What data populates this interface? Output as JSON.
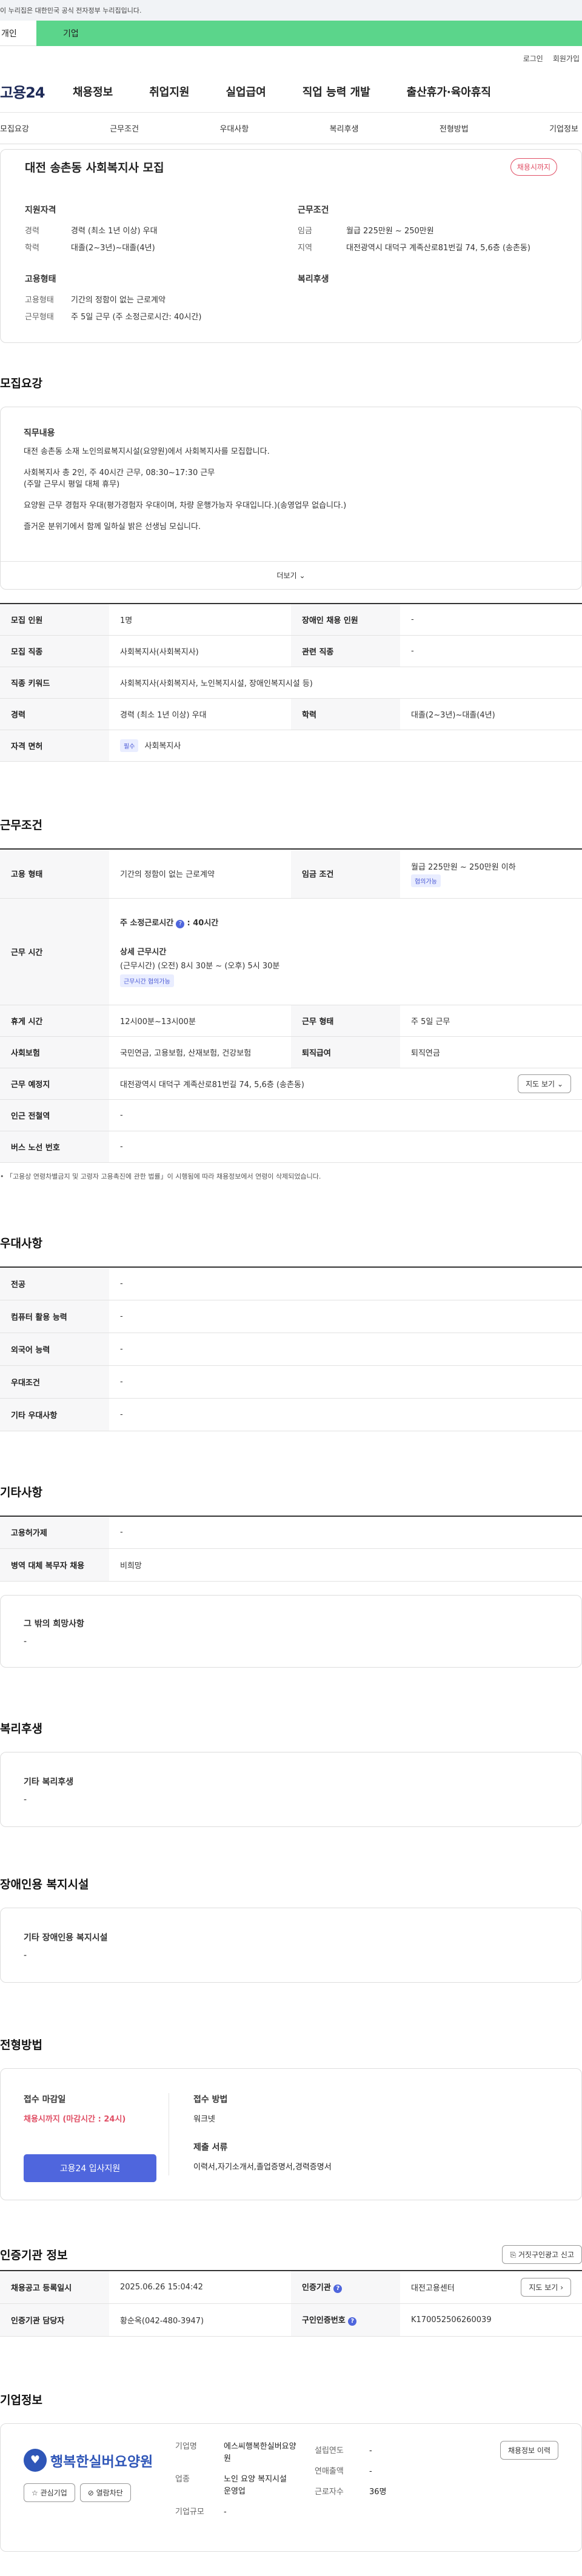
{
  "banner": {
    "text": "이 누리집은 대한민국 공식 전자정부 누리집입니다."
  },
  "top_tabs": [
    "개인",
    "기업"
  ],
  "util": [
    "로그인",
    "회원가입"
  ],
  "logo": "고용24",
  "gnb": [
    "채용정보",
    "취업지원",
    "실업급여",
    "직업 능력 개발",
    "출산휴가·육아휴직"
  ],
  "subnav": [
    "모집요강",
    "근무조건",
    "우대사항",
    "복리후생",
    "전형방법",
    "기업정보"
  ],
  "header": {
    "title": "대전 송촌동 사회복지사 모집",
    "badge": "채용시까지",
    "qual_title": "지원자격",
    "career_k": "경력",
    "career_v": "경력 (최소 1년 이상) 우대",
    "edu_k": "학력",
    "edu_v": "대졸(2~3년)~대졸(4년)",
    "cond_title": "근무조건",
    "wage_k": "임금",
    "wage_v": "월급 225만원 ~ 250만원",
    "loc_k": "지역",
    "loc_v": "대전광역시 대덕구 계족산로81번길 74, 5,6층 (송촌동)",
    "emp_title": "고용형태",
    "type_k": "고용형태",
    "type_v": "기간의 정함이 없는 근로계약",
    "form_k": "근무형태",
    "form_v": "주 5일 근무 (주 소정근로시간: 40시간)",
    "welfare_title": "복리후생"
  },
  "recruit": {
    "title": "모집요강",
    "duty_title": "직무내용",
    "lines": [
      "대전 송촌동 소재 노인의료복지시설(요양원)에서 사회복지사를 모집합니다.",
      "",
      "사회복지사 총 2인, 주 40시간 근무, 08:30~17:30 근무",
      "(주말 근무시 평일 대체 휴무)",
      "",
      "요양원 근무 경험자 우대(평가경험자 우대이며, 차량 운행가능자 우대입니다.)(송영업무 없습니다.)",
      "",
      "즐거운 분위기에서 함께 일하실 밝은 선생님 모십니다."
    ],
    "more": "더보기",
    "rows": [
      [
        "모집 인원",
        "1명",
        "장애인 채용 인원",
        "-"
      ],
      [
        "모집 직종",
        "사회복지사(사회복지사)",
        "관련 직종",
        "-"
      ],
      [
        "직종 키워드",
        "사회복지사(사회복지사, 노인복지시설, 장애인복지시설 등)"
      ],
      [
        "경력",
        "경력 (최소 1년 이상) 우대",
        "학력",
        "대졸(2~3년)~대졸(4년)"
      ],
      [
        "자격 면허",
        "필수",
        "사회복지사"
      ]
    ]
  },
  "work": {
    "title": "근무조건",
    "emp_k": "고용 형태",
    "emp_v": "기간의 정함이 없는 근로계약",
    "wage_k": "임금 조건",
    "wage_v": "월급 225만원 ~ 250만원 이하",
    "wage_chip": "협의가능",
    "time_k": "근무 시간",
    "weekly": "주 소정근로시간",
    "weekly_v": ": 40시간",
    "detail_title": "상세 근무시간",
    "detail_v": "(근무시간) (오전) 8시 30분 ~ (오후) 5시 30분",
    "detail_chip": "근무시간 협의가능",
    "rows": [
      [
        "휴게 시간",
        "12시00분~13시00분",
        "근무 형태",
        "주 5일 근무"
      ],
      [
        "사회보험",
        "국민연금, 고용보험, 산재보험, 건강보험",
        "퇴직급여",
        "퇴직연금"
      ]
    ],
    "place_k": "근무 예정지",
    "place_v": "대전광역시 대덕구 계족산로81번길 74, 5,6층 (송촌동)",
    "map_btn": "지도 보기",
    "station_k": "인근 전철역",
    "station_v": "-",
    "bus_k": "버스 노선 번호",
    "bus_v": "-",
    "note": "「고용상 연령차별금지 및 고령자 고용촉진에 관한 법률」이 시행됨에 따라 채용정보에서 연령이 삭제되었습니다."
  },
  "prefer": {
    "title": "우대사항",
    "rows": [
      [
        "전공",
        "-"
      ],
      [
        "컴퓨터 활용 능력",
        "-"
      ],
      [
        "외국어 능력",
        "-"
      ],
      [
        "우대조건",
        "-"
      ],
      [
        "기타 우대사항",
        "-"
      ]
    ]
  },
  "etc": {
    "title": "기타사항",
    "rows": [
      [
        "고용허가제",
        "-"
      ],
      [
        "병역 대체 복무자 채용",
        "비희망"
      ]
    ],
    "hope_title": "그 밖의 희망사항",
    "hope_v": "-"
  },
  "welfare": {
    "title": "복리후생",
    "box_title": "기타 복리후생",
    "box_v": "-"
  },
  "disabled": {
    "title": "장애인용 복지시설",
    "box_title": "기타 장애인용 복지시설",
    "box_v": "-"
  },
  "selection": {
    "title": "전형방법",
    "deadline_k": "접수 마감일",
    "deadline_v": "채용시까지 (마감시간 : 24시)",
    "apply_btn": "고용24 입사지원",
    "method_k": "접수 방법",
    "method_v": "워크넷",
    "docs_k": "제출 서류",
    "docs_v": "이력서,자기소개서,졸업증명서,경력증명서"
  },
  "agency": {
    "title": "인증기관 정보",
    "report_btn": "거짓구인광고 신고",
    "reg_k": "채용공고 등록일시",
    "reg_v": "2025.06.26 15:04:42",
    "org_k": "인증기관",
    "org_v": "대전고용센터",
    "map_btn": "지도 보기",
    "mgr_k": "인증기관 담당자",
    "mgr_v": "황순옥(042-480-3947)",
    "num_k": "구인인증번호",
    "num_v": "K170052506260039"
  },
  "company": {
    "title": "기업정보",
    "logo_text": "행복한실버요양원",
    "fav_btn": "관심기업",
    "block_btn": "열람차단",
    "name_k": "기업명",
    "name_v": "에스씨행복한실버요양원",
    "type_k": "업종",
    "type_v": "노인 요양 복지시설 운영업",
    "size_k": "기업규모",
    "size_v": "-",
    "year_k": "설립연도",
    "year_v": "-",
    "sales_k": "연매출액",
    "sales_v": "-",
    "staff_k": "근로자수",
    "staff_v": "36명",
    "jobs_btn": "채용정보 이력"
  },
  "colors": {
    "green": "#5bd58b",
    "red": "#e04f65",
    "button": "#4f66dd",
    "navy": "#1e2a57"
  }
}
